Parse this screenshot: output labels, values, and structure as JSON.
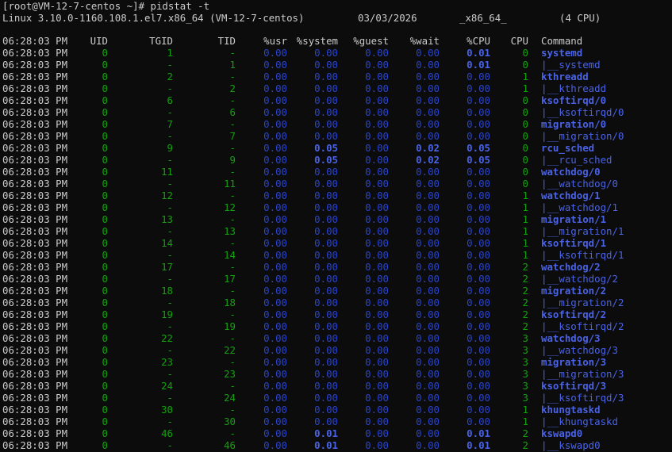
{
  "terminal": {
    "prompt_line": "[root@VM-12-7-centos ~]# pidstat -t",
    "sysinfo": {
      "kernel": "Linux 3.10.0-1160.108.1.el7.x86_64 (VM-12-7-centos)",
      "date": "03/03/2026",
      "arch": "_x86_64_",
      "cpus": "(4 CPU)"
    },
    "columns": [
      "06:28:03 PM",
      "UID",
      "TGID",
      "TID",
      "%usr",
      "%system",
      "%guest",
      "%wait",
      "%CPU",
      "CPU",
      "Command"
    ],
    "rows": [
      [
        "06:28:03 PM",
        "0",
        "1",
        "-",
        "0.00",
        "0.00",
        "0.00",
        "0.00",
        "0.01",
        "0",
        "systemd"
      ],
      [
        "06:28:03 PM",
        "0",
        "-",
        "1",
        "0.00",
        "0.00",
        "0.00",
        "0.00",
        "0.01",
        "0",
        "|__systemd"
      ],
      [
        "06:28:03 PM",
        "0",
        "2",
        "-",
        "0.00",
        "0.00",
        "0.00",
        "0.00",
        "0.00",
        "1",
        "kthreadd"
      ],
      [
        "06:28:03 PM",
        "0",
        "-",
        "2",
        "0.00",
        "0.00",
        "0.00",
        "0.00",
        "0.00",
        "1",
        "|__kthreadd"
      ],
      [
        "06:28:03 PM",
        "0",
        "6",
        "-",
        "0.00",
        "0.00",
        "0.00",
        "0.00",
        "0.00",
        "0",
        "ksoftirqd/0"
      ],
      [
        "06:28:03 PM",
        "0",
        "-",
        "6",
        "0.00",
        "0.00",
        "0.00",
        "0.00",
        "0.00",
        "0",
        "|__ksoftirqd/0"
      ],
      [
        "06:28:03 PM",
        "0",
        "7",
        "-",
        "0.00",
        "0.00",
        "0.00",
        "0.00",
        "0.00",
        "0",
        "migration/0"
      ],
      [
        "06:28:03 PM",
        "0",
        "-",
        "7",
        "0.00",
        "0.00",
        "0.00",
        "0.00",
        "0.00",
        "0",
        "|__migration/0"
      ],
      [
        "06:28:03 PM",
        "0",
        "9",
        "-",
        "0.00",
        "0.05",
        "0.00",
        "0.02",
        "0.05",
        "0",
        "rcu_sched"
      ],
      [
        "06:28:03 PM",
        "0",
        "-",
        "9",
        "0.00",
        "0.05",
        "0.00",
        "0.02",
        "0.05",
        "0",
        "|__rcu_sched"
      ],
      [
        "06:28:03 PM",
        "0",
        "11",
        "-",
        "0.00",
        "0.00",
        "0.00",
        "0.00",
        "0.00",
        "0",
        "watchdog/0"
      ],
      [
        "06:28:03 PM",
        "0",
        "-",
        "11",
        "0.00",
        "0.00",
        "0.00",
        "0.00",
        "0.00",
        "0",
        "|__watchdog/0"
      ],
      [
        "06:28:03 PM",
        "0",
        "12",
        "-",
        "0.00",
        "0.00",
        "0.00",
        "0.00",
        "0.00",
        "1",
        "watchdog/1"
      ],
      [
        "06:28:03 PM",
        "0",
        "-",
        "12",
        "0.00",
        "0.00",
        "0.00",
        "0.00",
        "0.00",
        "1",
        "|__watchdog/1"
      ],
      [
        "06:28:03 PM",
        "0",
        "13",
        "-",
        "0.00",
        "0.00",
        "0.00",
        "0.00",
        "0.00",
        "1",
        "migration/1"
      ],
      [
        "06:28:03 PM",
        "0",
        "-",
        "13",
        "0.00",
        "0.00",
        "0.00",
        "0.00",
        "0.00",
        "1",
        "|__migration/1"
      ],
      [
        "06:28:03 PM",
        "0",
        "14",
        "-",
        "0.00",
        "0.00",
        "0.00",
        "0.00",
        "0.00",
        "1",
        "ksoftirqd/1"
      ],
      [
        "06:28:03 PM",
        "0",
        "-",
        "14",
        "0.00",
        "0.00",
        "0.00",
        "0.00",
        "0.00",
        "1",
        "|__ksoftirqd/1"
      ],
      [
        "06:28:03 PM",
        "0",
        "17",
        "-",
        "0.00",
        "0.00",
        "0.00",
        "0.00",
        "0.00",
        "2",
        "watchdog/2"
      ],
      [
        "06:28:03 PM",
        "0",
        "-",
        "17",
        "0.00",
        "0.00",
        "0.00",
        "0.00",
        "0.00",
        "2",
        "|__watchdog/2"
      ],
      [
        "06:28:03 PM",
        "0",
        "18",
        "-",
        "0.00",
        "0.00",
        "0.00",
        "0.00",
        "0.00",
        "2",
        "migration/2"
      ],
      [
        "06:28:03 PM",
        "0",
        "-",
        "18",
        "0.00",
        "0.00",
        "0.00",
        "0.00",
        "0.00",
        "2",
        "|__migration/2"
      ],
      [
        "06:28:03 PM",
        "0",
        "19",
        "-",
        "0.00",
        "0.00",
        "0.00",
        "0.00",
        "0.00",
        "2",
        "ksoftirqd/2"
      ],
      [
        "06:28:03 PM",
        "0",
        "-",
        "19",
        "0.00",
        "0.00",
        "0.00",
        "0.00",
        "0.00",
        "2",
        "|__ksoftirqd/2"
      ],
      [
        "06:28:03 PM",
        "0",
        "22",
        "-",
        "0.00",
        "0.00",
        "0.00",
        "0.00",
        "0.00",
        "3",
        "watchdog/3"
      ],
      [
        "06:28:03 PM",
        "0",
        "-",
        "22",
        "0.00",
        "0.00",
        "0.00",
        "0.00",
        "0.00",
        "3",
        "|__watchdog/3"
      ],
      [
        "06:28:03 PM",
        "0",
        "23",
        "-",
        "0.00",
        "0.00",
        "0.00",
        "0.00",
        "0.00",
        "3",
        "migration/3"
      ],
      [
        "06:28:03 PM",
        "0",
        "-",
        "23",
        "0.00",
        "0.00",
        "0.00",
        "0.00",
        "0.00",
        "3",
        "|__migration/3"
      ],
      [
        "06:28:03 PM",
        "0",
        "24",
        "-",
        "0.00",
        "0.00",
        "0.00",
        "0.00",
        "0.00",
        "3",
        "ksoftirqd/3"
      ],
      [
        "06:28:03 PM",
        "0",
        "-",
        "24",
        "0.00",
        "0.00",
        "0.00",
        "0.00",
        "0.00",
        "3",
        "|__ksoftirqd/3"
      ],
      [
        "06:28:03 PM",
        "0",
        "30",
        "-",
        "0.00",
        "0.00",
        "0.00",
        "0.00",
        "0.00",
        "1",
        "khungtaskd"
      ],
      [
        "06:28:03 PM",
        "0",
        "-",
        "30",
        "0.00",
        "0.00",
        "0.00",
        "0.00",
        "0.00",
        "1",
        "|__khungtaskd"
      ],
      [
        "06:28:03 PM",
        "0",
        "46",
        "-",
        "0.00",
        "0.01",
        "0.00",
        "0.00",
        "0.01",
        "2",
        "kswapd0"
      ],
      [
        "06:28:03 PM",
        "0",
        "-",
        "46",
        "0.00",
        "0.01",
        "0.00",
        "0.00",
        "0.01",
        "2",
        "|__kswapd0"
      ]
    ]
  },
  "colors": {
    "background": "#0c0c0c",
    "default_text": "#cccccc",
    "id_green": "#13a10e",
    "zero_value": "#2b44c8",
    "nonzero_value": "#4a63e6",
    "command": "#4a63e6"
  }
}
